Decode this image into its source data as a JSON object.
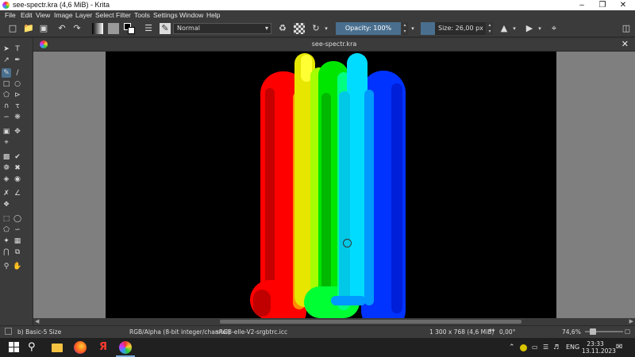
{
  "window": {
    "title": "see-spectr.kra (4,6 MiB) - Krita"
  },
  "menu": [
    "File",
    "Edit",
    "View",
    "Image",
    "Layer",
    "Select",
    "Filter",
    "Tools",
    "Settings",
    "Window",
    "Help"
  ],
  "toolbar": {
    "blend_mode": "Normal",
    "opacity_label": "Opacity: 100%",
    "opacity": 1.0,
    "size_label": "Size: 26,00 px"
  },
  "document": {
    "tab_title": "see-spectr.kra"
  },
  "status": {
    "brush": "b) Basic-5 Size",
    "color_model": "RGB/Alpha (8-bit integer/channel)",
    "profile": "sRGB-elle-V2-srgbtrc.icc",
    "image_size": "1 300 x 768 (4,6 MiB)",
    "rotation": "0,00°",
    "zoom": "74,6%"
  },
  "taskbar": {
    "language": "ENG",
    "time": "23:33",
    "date": "13.11.2023"
  },
  "colors": {
    "accent": "#4a6f8e",
    "panel": "#3b3b3b",
    "canvas_bg": "#000000"
  }
}
